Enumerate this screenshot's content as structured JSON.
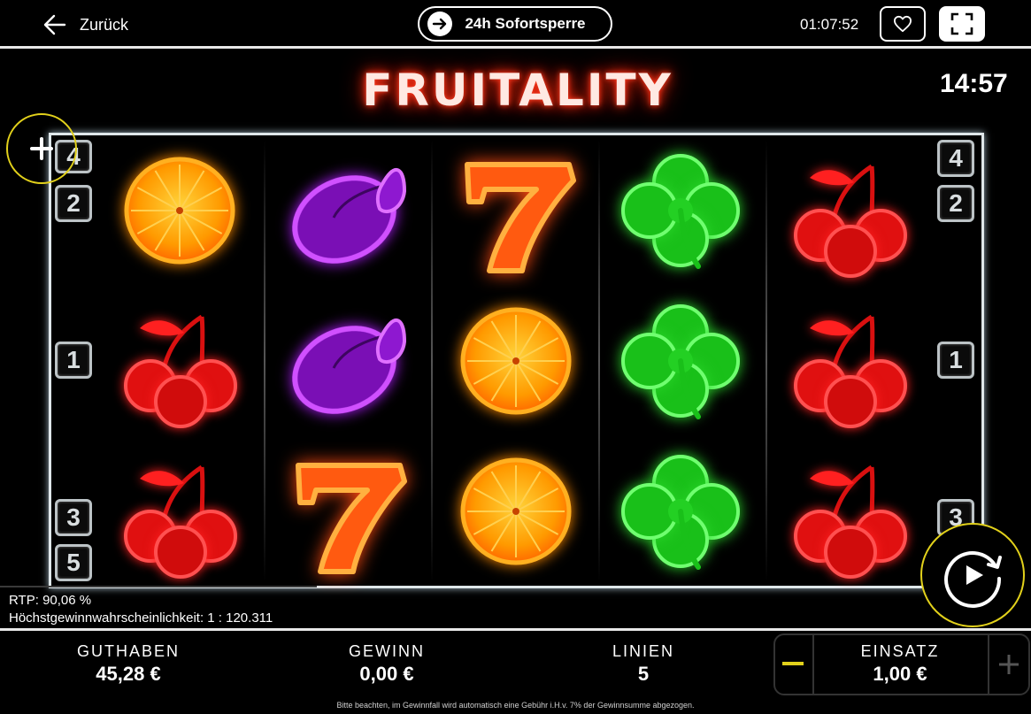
{
  "topbar": {
    "back_label": "Zurück",
    "sperre_label": "24h Sofortsperre",
    "clock": "01:07:52"
  },
  "game": {
    "title": "FRUITALITY",
    "timer": "14:57",
    "reels": [
      [
        "orange",
        "cherry",
        "cherry"
      ],
      [
        "plum",
        "plum",
        "seven"
      ],
      [
        "seven",
        "orange",
        "orange"
      ],
      [
        "clover",
        "clover",
        "clover"
      ],
      [
        "cherry",
        "cherry",
        "cherry"
      ]
    ],
    "left_lines": [
      "4",
      "2",
      "1",
      "3",
      "5"
    ],
    "right_lines": [
      "4",
      "2",
      "1",
      "3"
    ],
    "rtp": "RTP: 90,06 %",
    "max_win_probability": "Höchstgewinnwahrscheinlichkeit: 1 : 120.311"
  },
  "bottombar": {
    "guthaben_label": "GUTHABEN",
    "guthaben_value": "45,28 €",
    "gewinn_label": "GEWINN",
    "gewinn_value": "0,00 €",
    "linien_label": "LINIEN",
    "linien_value": "5",
    "einsatz_label": "EINSATZ",
    "einsatz_value": "1,00 €",
    "note": "Bitte beachten, im Gewinnfall wird automatisch eine Gebühr i.H.v. 7% der Gewinnsumme abgezogen."
  },
  "colors": {
    "accent_yellow": "#e2d11b",
    "orange": "#ff8a00",
    "cherry": "#ff1f1f",
    "plum": "#b01cff",
    "clover": "#2bd62b",
    "seven": "#ff4a10"
  }
}
